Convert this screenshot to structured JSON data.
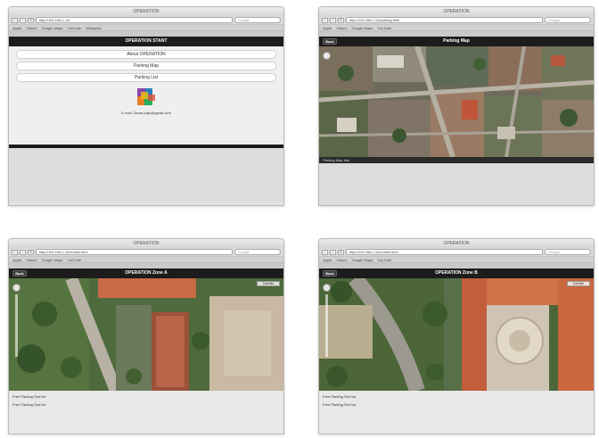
{
  "windows": [
    {
      "title": "OPERATION",
      "url": "http://192.168.1.10/",
      "search_placeholder": "Google",
      "tab": "OPERATION",
      "app_title": "OPERATION STANT",
      "menu": [
        "About OPERATION",
        "Parking Map",
        "Parking List"
      ],
      "email": "E-mail: Zoran.pajic@gmail.com"
    },
    {
      "title": "OPERATION",
      "url": "http://192.168.1.10/parking.html",
      "search_placeholder": "Google",
      "tab": "OPERATION",
      "back": "Back",
      "app_title": "Parking Map",
      "status": "Parking Map Info"
    },
    {
      "title": "OPERATION",
      "url": "http://192.168.1.10/zoneA.html",
      "search_placeholder": "Google",
      "tab": "OPERATION",
      "back": "Back",
      "app_title": "OPERATION Zone A",
      "map_type": "Satellite",
      "lines": [
        "Free Parking Slot No:",
        "Free Parking Slot No:"
      ]
    },
    {
      "title": "OPERATION",
      "url": "http://192.168.1.10/zoneB.html",
      "search_placeholder": "Google",
      "tab": "OPERATION",
      "back": "Back",
      "app_title": "OPERATION Zone B",
      "map_type": "Satellite",
      "lines": [
        "Free Parking Slot No:",
        "Free Parking Slot No:"
      ]
    }
  ],
  "bookmarks": [
    "Apple",
    "Yahoo!",
    "Google Maps",
    "YouTube",
    "Wikipedia",
    "News",
    "Popular"
  ],
  "colors": {
    "appbar": "#1c1c1c",
    "chrome": "#dadada",
    "page": "#efefef"
  }
}
